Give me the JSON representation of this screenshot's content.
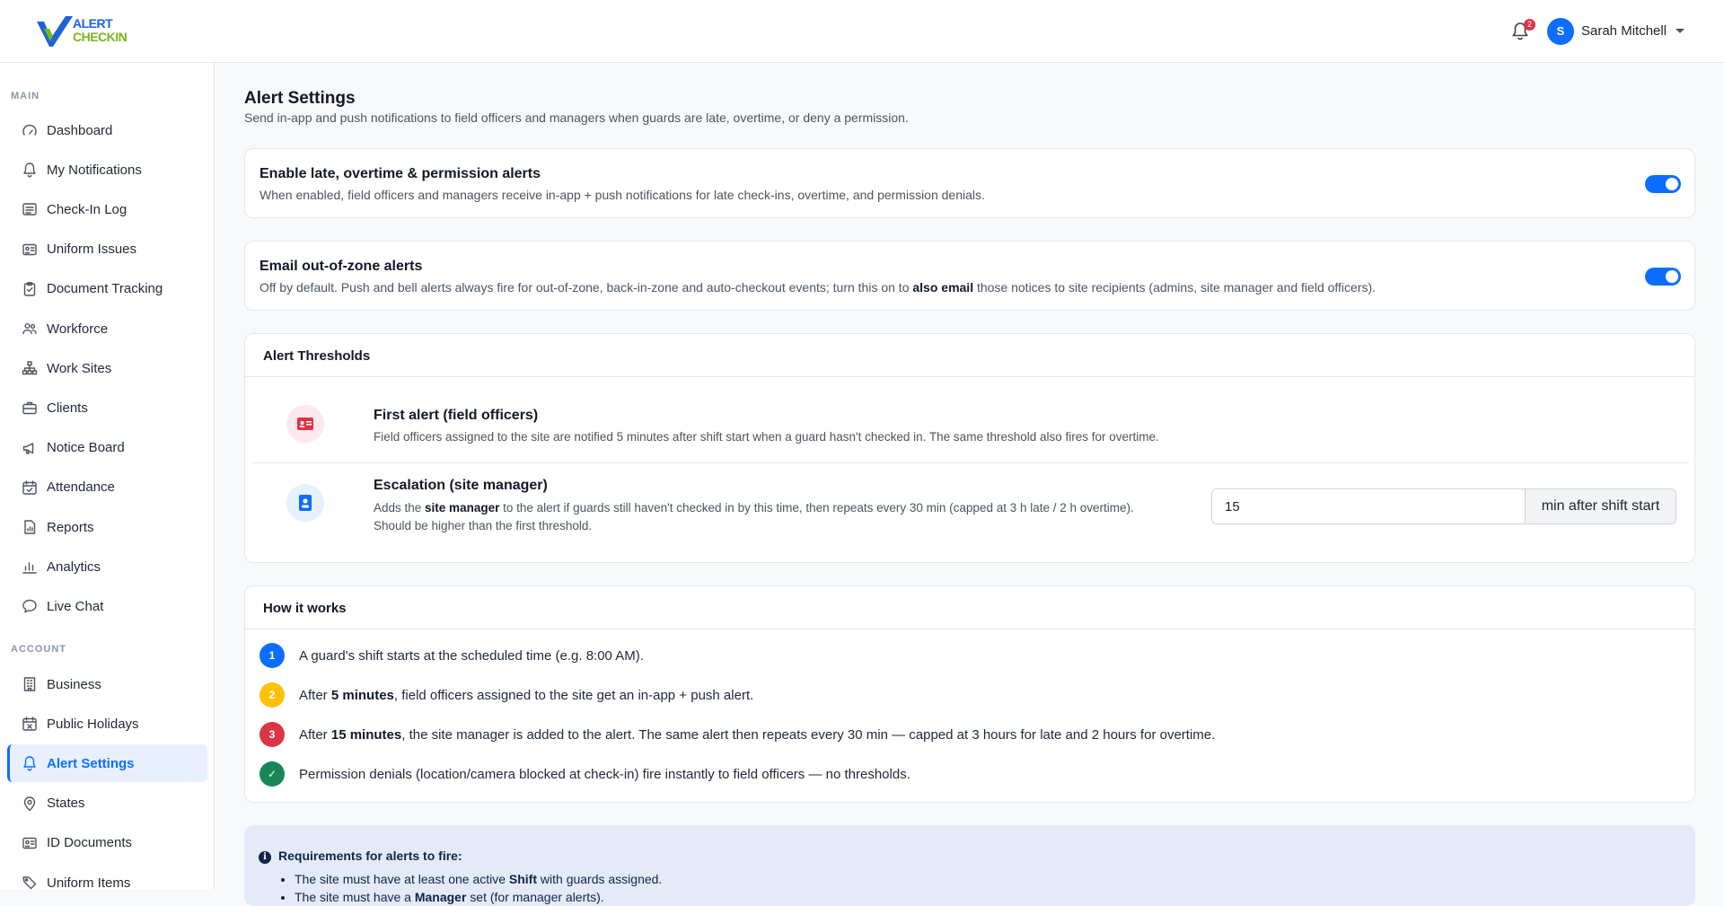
{
  "header": {
    "logo_line1": "ALERT",
    "logo_line2": "CHECKIN",
    "notification_count": "2",
    "avatar_initial": "S",
    "user_name": "Sarah Mitchell"
  },
  "sidebar": {
    "main_label": "MAIN",
    "account_label": "ACCOUNT",
    "main_items": [
      {
        "label": "Dashboard",
        "icon": "gauge-icon"
      },
      {
        "label": "My Notifications",
        "icon": "bell-icon"
      },
      {
        "label": "Check-In Log",
        "icon": "list-card-icon"
      },
      {
        "label": "Uniform Issues",
        "icon": "id-card-icon"
      },
      {
        "label": "Document Tracking",
        "icon": "clipboard-icon"
      },
      {
        "label": "Workforce",
        "icon": "people-icon"
      },
      {
        "label": "Work Sites",
        "icon": "sitemap-icon"
      },
      {
        "label": "Clients",
        "icon": "briefcase-icon"
      },
      {
        "label": "Notice Board",
        "icon": "megaphone-icon"
      },
      {
        "label": "Attendance",
        "icon": "calendar-check-icon"
      },
      {
        "label": "Reports",
        "icon": "report-file-icon"
      },
      {
        "label": "Analytics",
        "icon": "bar-chart-icon"
      },
      {
        "label": "Live Chat",
        "icon": "chat-icon"
      }
    ],
    "account_items": [
      {
        "label": "Business",
        "icon": "building-icon"
      },
      {
        "label": "Public Holidays",
        "icon": "calendar-x-icon"
      },
      {
        "label": "Alert Settings",
        "icon": "bell-icon",
        "active": true
      },
      {
        "label": "States",
        "icon": "map-pin-icon"
      },
      {
        "label": "ID Documents",
        "icon": "id-card-icon"
      },
      {
        "label": "Uniform Items",
        "icon": "tags-icon"
      }
    ]
  },
  "page": {
    "title": "Alert Settings",
    "subtitle": "Send in-app and push notifications to field officers and managers when guards are late, overtime, or deny a permission."
  },
  "late_alerts": {
    "title": "Enable late, overtime & permission alerts",
    "description": "When enabled, field officers and managers receive in-app + push notifications for late check-ins, overtime, and permission denials.",
    "enabled": true
  },
  "email_alerts": {
    "title": "Email out-of-zone alerts",
    "desc_before": "Off by default. Push and bell alerts always fire for out-of-zone, back-in-zone and auto-checkout events; turn this on to ",
    "desc_bold": "also email",
    "desc_after": " those notices to site recipients (admins, site manager and field officers).",
    "enabled": true
  },
  "thresholds": {
    "header": "Alert Thresholds",
    "first": {
      "title": "First alert (field officers)",
      "description": "Field officers assigned to the site are notified 5 minutes after shift start when a guard hasn't checked in. The same threshold also fires for overtime."
    },
    "escalation": {
      "title": "Escalation (site manager)",
      "desc_before": "Adds the ",
      "desc_bold": "site manager",
      "desc_after": " to the alert if guards still haven't checked in by this time, then repeats every 30 min (capped at 3 h late / 2 h overtime).",
      "desc_line2": "Should be higher than the first threshold.",
      "value": "15",
      "unit": "min after shift start"
    }
  },
  "how_it_works": {
    "header": "How it works",
    "steps": [
      {
        "num": "1",
        "color": "#0d6efd",
        "before": "A guard's shift starts at the scheduled time (e.g. 8:00 AM).",
        "bold": "",
        "after": ""
      },
      {
        "num": "2",
        "color": "#ffc107",
        "before": "After ",
        "bold": "5 minutes",
        "after": ", field officers assigned to the site get an in-app + push alert."
      },
      {
        "num": "3",
        "color": "#dc3545",
        "before": "After ",
        "bold": "15 minutes",
        "after": ", the site manager is added to the alert. The same alert then repeats every 30 min — capped at 3 hours for late and 2 hours for overtime."
      },
      {
        "num": "✓",
        "color": "#198754",
        "before": "Permission denials (location/camera blocked at check-in) fire instantly to field officers — no thresholds.",
        "bold": "",
        "after": ""
      }
    ]
  },
  "requirements": {
    "title": "Requirements for alerts to fire:",
    "items": [
      {
        "before": "The site must have at least one active ",
        "bold": "Shift",
        "after": " with guards assigned."
      },
      {
        "before": "The site must have a ",
        "bold": "Manager",
        "after": " set (for manager alerts)."
      }
    ]
  }
}
